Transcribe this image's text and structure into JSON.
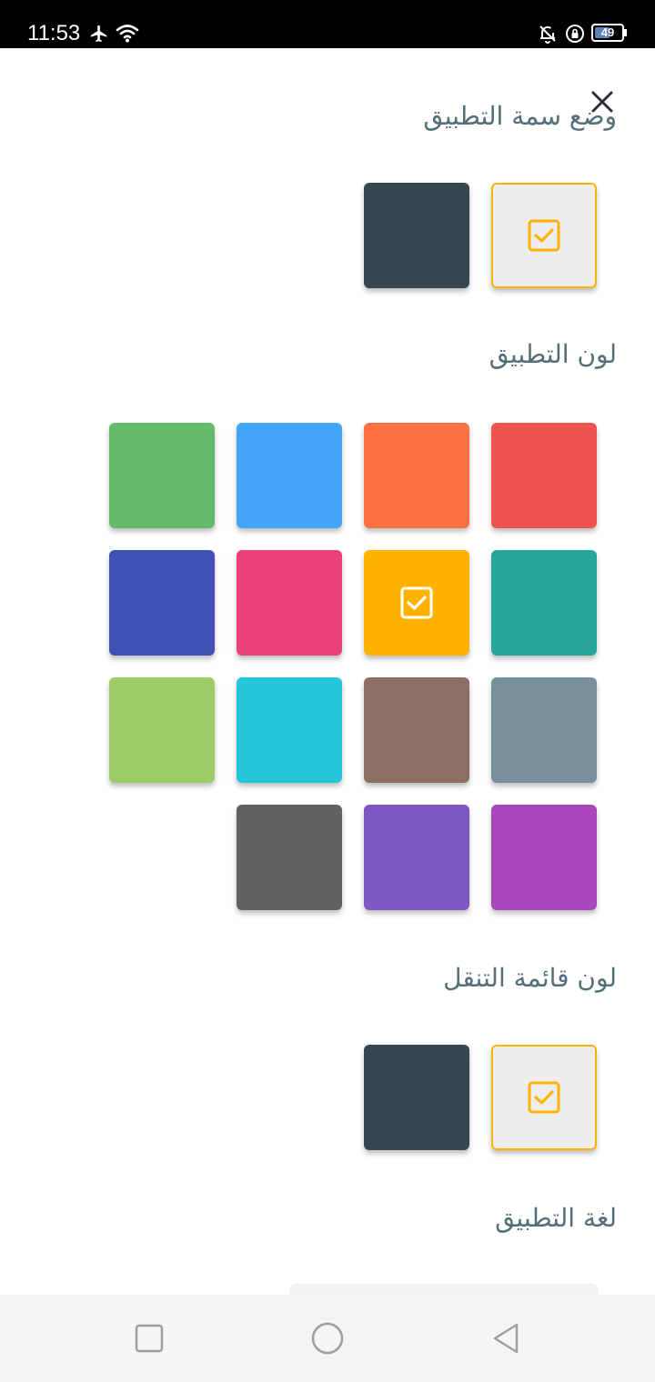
{
  "status_bar": {
    "time": "11:53",
    "battery_level": "49",
    "icons": [
      "airplane-icon",
      "wifi-icon",
      "bell-off-icon",
      "lock-rotation-icon",
      "battery-icon"
    ]
  },
  "colors": {
    "accent": "#ffb300",
    "title_text": "#546e7a"
  },
  "sections": {
    "theme_mode": {
      "title": "وضع سمة التطبيق"
    },
    "app_color": {
      "title": "لون التطبيق"
    },
    "nav_color": {
      "title": "لون قائمة التنقل"
    },
    "language": {
      "title": "لغة التطبيق"
    }
  },
  "theme_mode_options": [
    {
      "name": "light",
      "color": "#eeeeee",
      "selected": true
    },
    {
      "name": "dark",
      "color": "#37474f",
      "selected": false
    }
  ],
  "app_color_options": [
    {
      "color": "#ef5350",
      "selected": false
    },
    {
      "color": "#ff7043",
      "selected": false
    },
    {
      "color": "#42a5f5",
      "selected": false
    },
    {
      "color": "#66bb6a",
      "selected": false
    },
    {
      "color": "#26a69a",
      "selected": false
    },
    {
      "color": "#ffb300",
      "selected": true
    },
    {
      "color": "#ec407a",
      "selected": false
    },
    {
      "color": "#3f51b5",
      "selected": false
    },
    {
      "color": "#78909c",
      "selected": false
    },
    {
      "color": "#8d6e63",
      "selected": false
    },
    {
      "color": "#26c6da",
      "selected": false
    },
    {
      "color": "#9ccc65",
      "selected": false
    },
    {
      "color": "#ab47bc",
      "selected": false
    },
    {
      "color": "#7e57c2",
      "selected": false
    },
    {
      "color": "#616161",
      "selected": false
    }
  ],
  "nav_color_options": [
    {
      "name": "light",
      "color": "#eeeeee",
      "selected": true
    },
    {
      "name": "dark",
      "color": "#37474f",
      "selected": false
    }
  ],
  "nav_bar": [
    "recent-apps-icon",
    "home-icon",
    "back-icon"
  ]
}
